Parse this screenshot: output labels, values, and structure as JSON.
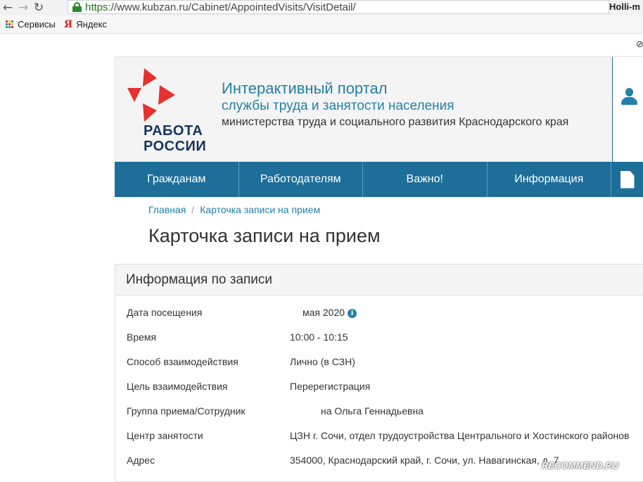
{
  "browser": {
    "url_scheme": "https",
    "url_rest": "://www.kubzan.ru/Cabinet/AppointedVisits/VisitDetail/",
    "profile_name": "Holli-m"
  },
  "bookmarks": {
    "apps_label": "Сервисы",
    "yandex_label": "Яндекс"
  },
  "header": {
    "logo_line_1": "РАБОТА",
    "logo_line_2": "РОССИИ",
    "title_1": "Интерактивный портал",
    "title_2": "службы труда и занятости населения",
    "title_3": "министерства труда и социального развития Краснодарского края"
  },
  "nav": {
    "items": [
      {
        "label": "Гражданам"
      },
      {
        "label": "Работодателям"
      },
      {
        "label": "Важно!"
      },
      {
        "label": "Информация"
      }
    ]
  },
  "breadcrumb": {
    "home": "Главная",
    "separator": "/",
    "current": "Карточка записи на прием"
  },
  "page": {
    "title": "Карточка записи на прием"
  },
  "info": {
    "header": "Информация по записи",
    "rows": [
      {
        "label": "Дата посещения",
        "value": "мая 2020"
      },
      {
        "label": "Время",
        "value": "10:00 - 10:15"
      },
      {
        "label": "Способ взаимодействия",
        "value": "Лично (в СЗН)"
      },
      {
        "label": "Цель взаимодействия",
        "value": "Перерегистрация"
      },
      {
        "label": "Группа приема/Сотрудник",
        "value": "на Ольга Геннадьевна"
      },
      {
        "label": "Центр занятости",
        "value": "ЦЗН г. Сочи, отдел трудоустройства Центрального и Хостинского районов"
      },
      {
        "label": "Адрес",
        "value": "354000, Краснодарский край, г. Сочи, ул. Навагинская, д. 7"
      }
    ]
  },
  "watermark": "RECOMMEND.RU",
  "colors": {
    "brand_blue": "#2380a8",
    "nav_bg": "#1d6e99",
    "logo_red": "#e5312f",
    "logo_navy": "#17345e"
  }
}
